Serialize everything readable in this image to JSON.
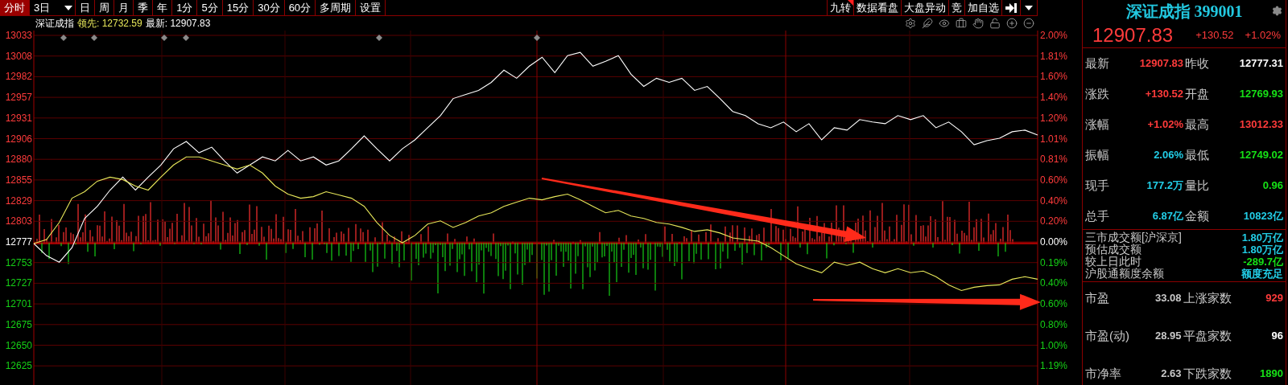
{
  "toolbar": {
    "period_tabs": [
      {
        "label": "分时",
        "selected": true,
        "kind": "plain"
      },
      {
        "label": "3日",
        "selected": false,
        "kind": "dropdown"
      },
      {
        "label": "日",
        "selected": false,
        "kind": "plain"
      },
      {
        "label": "周",
        "selected": false,
        "kind": "plain"
      },
      {
        "label": "月",
        "selected": false,
        "kind": "plain"
      },
      {
        "label": "季",
        "selected": false,
        "kind": "plain"
      },
      {
        "label": "年",
        "selected": false,
        "kind": "plain"
      },
      {
        "label": "1分",
        "selected": false,
        "kind": "plain"
      },
      {
        "label": "5分",
        "selected": false,
        "kind": "plain"
      },
      {
        "label": "15分",
        "selected": false,
        "kind": "plain"
      },
      {
        "label": "30分",
        "selected": false,
        "kind": "plain"
      },
      {
        "label": "60分",
        "selected": false,
        "kind": "plain"
      },
      {
        "label": "多周期",
        "selected": false,
        "kind": "plain"
      },
      {
        "label": "设置",
        "selected": false,
        "kind": "plain"
      }
    ],
    "tools": [
      {
        "label": "九转",
        "kind": "flagged"
      },
      {
        "label": "数据看盘",
        "kind": "plain"
      },
      {
        "label": "大盘异动",
        "kind": "plain"
      },
      {
        "label": "竞",
        "kind": "plain"
      },
      {
        "label": "加自选",
        "kind": "plain"
      }
    ]
  },
  "info_bar": {
    "name": "深证成指",
    "lead": "领先: 12732.59",
    "latest": "最新: 12907.83"
  },
  "chart": {
    "percent_labels": [
      {
        "label": "2.00%",
        "color": "#ff3b3b"
      },
      {
        "label": "1.81%",
        "color": "#ff3b3b"
      },
      {
        "label": "1.60%",
        "color": "#ff3b3b"
      },
      {
        "label": "1.40%",
        "color": "#ff3b3b"
      },
      {
        "label": "1.20%",
        "color": "#ff3b3b"
      },
      {
        "label": "1.01%",
        "color": "#ff3b3b"
      },
      {
        "label": "0.81%",
        "color": "#ff3b3b"
      },
      {
        "label": "0.60%",
        "color": "#ff3b3b"
      },
      {
        "label": "0.40%",
        "color": "#ff3b3b"
      },
      {
        "label": "0.20%",
        "color": "#ff3b3b"
      },
      {
        "label": "0.00%",
        "color": "#ffffff"
      },
      {
        "label": "0.19%",
        "color": "#16d016"
      },
      {
        "label": "0.40%",
        "color": "#16d016"
      },
      {
        "label": "0.60%",
        "color": "#16d016"
      },
      {
        "label": "0.80%",
        "color": "#16d016"
      },
      {
        "label": "1.00%",
        "color": "#16d016"
      },
      {
        "label": "1.19%",
        "color": "#16d016"
      }
    ],
    "chart_data": {
      "type": "line",
      "grid": true,
      "yticks": [
        13033,
        13008,
        12982,
        12957,
        12931,
        12906,
        12880,
        12855,
        12829,
        12803,
        12777,
        12753,
        12727,
        12701,
        12675,
        12650,
        12625
      ],
      "ylim": [
        12625,
        13033
      ],
      "series": [
        {
          "color": "#ffffff",
          "values": [
            12776,
            12761,
            12753,
            12771,
            12807,
            12822,
            12842,
            12858,
            12842,
            12858,
            12873,
            12893,
            12902,
            12888,
            12895,
            12878,
            12863,
            12873,
            12883,
            12878,
            12891,
            12878,
            12883,
            12873,
            12878,
            12893,
            12909,
            12893,
            12878,
            12893,
            12904,
            12919,
            12934,
            12955,
            12960,
            12965,
            12975,
            12990,
            12980,
            12995,
            13006,
            12987,
            13008,
            13012,
            12995,
            13001,
            13008,
            12985,
            12970,
            12980,
            12975,
            12980,
            12965,
            12970,
            12955,
            12939,
            12934,
            12924,
            12919,
            12926,
            12914,
            12924,
            12904,
            12919,
            12916,
            12929,
            12926,
            12924,
            12934,
            12929,
            12934,
            12919,
            12926,
            12914,
            12898,
            12903,
            12906,
            12914,
            12916,
            12910
          ]
        },
        {
          "color": "#e8e85a",
          "values": [
            12776,
            12781,
            12802,
            12832,
            12840,
            12853,
            12858,
            12855,
            12847,
            12842,
            12858,
            12873,
            12883,
            12883,
            12878,
            12873,
            12868,
            12873,
            12863,
            12847,
            12837,
            12832,
            12834,
            12840,
            12836,
            12832,
            12822,
            12802,
            12786,
            12777,
            12786,
            12800,
            12804,
            12796,
            12802,
            12810,
            12814,
            12822,
            12827,
            12832,
            12830,
            12834,
            12837,
            12830,
            12822,
            12814,
            12817,
            12810,
            12807,
            12802,
            12800,
            12796,
            12791,
            12793,
            12789,
            12783,
            12781,
            12779,
            12771,
            12761,
            12751,
            12745,
            12740,
            12753,
            12749,
            12753,
            12745,
            12740,
            12745,
            12740,
            12742,
            12735,
            12725,
            12718,
            12722,
            12724,
            12725,
            12732,
            12735,
            12732
          ]
        }
      ]
    }
  },
  "quote_panel": {
    "title": "深证成指 399001",
    "price": "12907.83",
    "change": "+130.52",
    "change_pct": "+1.02%",
    "stats": [
      {
        "label": "最新",
        "value": "12907.83",
        "color": "#ff3b3b"
      },
      {
        "label": "昨收",
        "value": "12777.31",
        "color": "#ffffff"
      },
      {
        "label": "涨跌",
        "value": "+130.52",
        "color": "#ff3b3b"
      },
      {
        "label": "开盘",
        "value": "12769.93",
        "color": "#16e016"
      },
      {
        "label": "涨幅",
        "value": "+1.02%",
        "color": "#ff3b3b"
      },
      {
        "label": "最高",
        "value": "13012.33",
        "color": "#ff3b3b"
      },
      {
        "label": "振幅",
        "value": "2.06%",
        "color": "#22cde6"
      },
      {
        "label": "最低",
        "value": "12749.02",
        "color": "#16e016"
      },
      {
        "label": "现手",
        "value": "177.2万",
        "color": "#22cde6"
      },
      {
        "label": "量比",
        "value": "0.96",
        "color": "#16e016"
      },
      {
        "label": "总手",
        "value": "6.87亿",
        "color": "#22cde6"
      },
      {
        "label": "金额",
        "value": "10823亿",
        "color": "#22cde6"
      }
    ],
    "turnover": [
      {
        "label": "三市成交额[沪深京]",
        "value": "1.80万亿",
        "color": "#22cde6"
      },
      {
        "label": "预估成交额",
        "value": "1.80万亿",
        "color": "#22cde6"
      },
      {
        "label": "较上日此时",
        "value": "-289.7亿",
        "color": "#16e016"
      },
      {
        "label": "沪股通额度余额",
        "value": "额度充足",
        "color": "#22cde6"
      }
    ],
    "market": [
      {
        "label": "市盈",
        "value": "33.08",
        "color": "#c8c8c8"
      },
      {
        "label": "上涨家数",
        "value": "929",
        "color": "#ff3b3b"
      },
      {
        "label": "市盈(动)",
        "value": "28.95",
        "color": "#c8c8c8"
      },
      {
        "label": "平盘家数",
        "value": "96",
        "color": "#ffffff"
      },
      {
        "label": "市净率",
        "value": "2.63",
        "color": "#c8c8c8"
      },
      {
        "label": "下跌家数",
        "value": "1890",
        "color": "#16e016"
      }
    ]
  }
}
